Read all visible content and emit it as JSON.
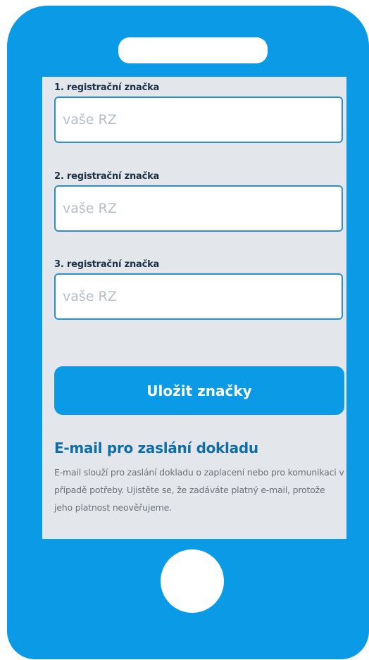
{
  "fields": [
    {
      "label": "1. registrační značka",
      "value": "",
      "placeholder": "vaše RZ"
    },
    {
      "label": "2. registrační značka",
      "value": "",
      "placeholder": "vaše RZ"
    },
    {
      "label": "3. registrační značka",
      "value": "",
      "placeholder": "vaše RZ"
    }
  ],
  "save_button": {
    "label": "Uložit značky"
  },
  "email_section": {
    "heading": "E-mail pro zaslání dokladu",
    "description": "E-mail slouží pro zaslání dokladu o zaplacení nebo pro komunikaci v případě potřeby. Ujistěte se, že zadáváte platný e-mail, protože jeho platnost neověřujeme."
  },
  "colors": {
    "phone_body": "#0a9ae6",
    "screen_background": "#e3e6ea",
    "input_border": "#2b8fcb",
    "heading": "#0f6ea7",
    "button": "#0a9ae6"
  }
}
